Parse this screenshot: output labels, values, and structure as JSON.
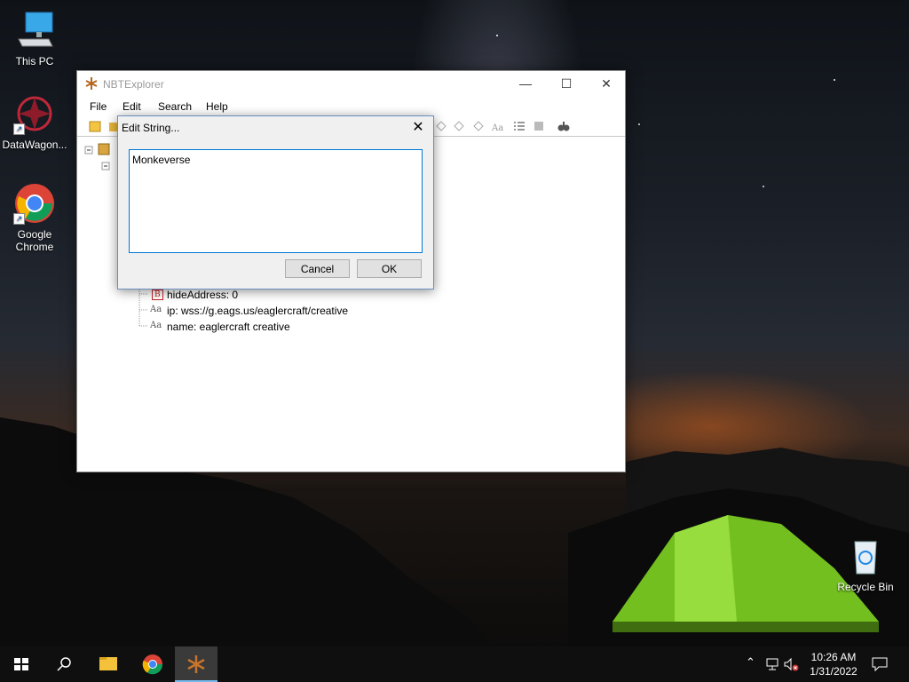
{
  "desktop": {
    "icons": [
      {
        "label": "This PC"
      },
      {
        "label": "DataWagon..."
      },
      {
        "label": "Google Chrome"
      },
      {
        "label": "Recycle Bin"
      }
    ]
  },
  "window": {
    "title": "NBTExplorer",
    "menu": [
      "File",
      "Edit",
      "Search",
      "Help"
    ],
    "tree": [
      {
        "tag": "B",
        "label": "hideAddress: 0"
      },
      {
        "tag": "Aa",
        "label": "ip: wss://g.eags.us/eaglercraft/creative"
      },
      {
        "tag": "Aa",
        "label": "name: eaglercraft creative"
      }
    ]
  },
  "dialog": {
    "title": "Edit String...",
    "value": "Monkeverse",
    "cancel_label": "Cancel",
    "ok_label": "OK"
  },
  "taskbar": {
    "time": "10:26 AM",
    "date": "1/31/2022"
  },
  "colors": {
    "accent": "#0078d7",
    "tent": "#7ed321",
    "taskbar": "#101010"
  }
}
